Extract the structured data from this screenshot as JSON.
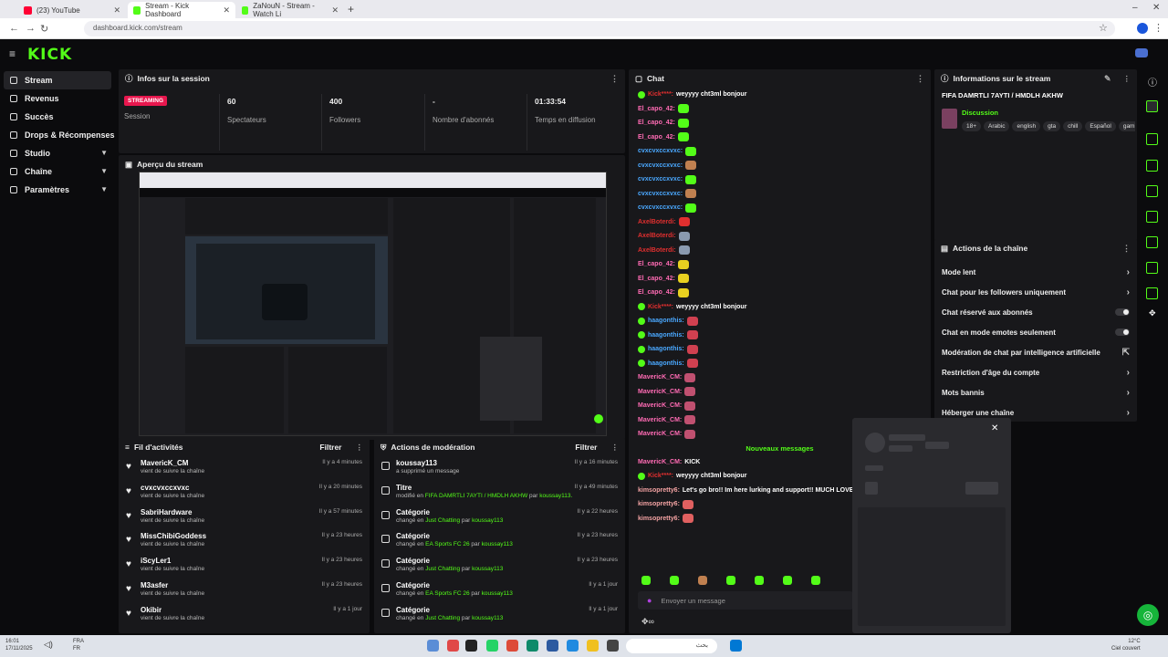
{
  "browser": {
    "tabs": [
      {
        "title": "(23) YouTube",
        "fav": "#ff0033"
      },
      {
        "title": "Stream - Kick Dashboard",
        "fav": "#53fc18"
      },
      {
        "title": "ZaNouN - Stream - Watch Li",
        "fav": "#53fc18"
      }
    ],
    "url": "dashboard.kick.com/stream"
  },
  "app": {
    "logo": "KICK"
  },
  "sidebar": {
    "items": [
      {
        "label": "Stream",
        "active": true
      },
      {
        "label": "Revenus"
      },
      {
        "label": "Succès"
      },
      {
        "label": "Drops & Récompenses"
      },
      {
        "label": "Studio",
        "expand": true
      },
      {
        "label": "Chaîne",
        "expand": true
      },
      {
        "label": "Paramètres",
        "expand": true
      }
    ]
  },
  "session": {
    "title": "Infos sur la session",
    "badge": "STREAMING",
    "badge_label": "Session",
    "stats": [
      {
        "value": "60",
        "label": "Spectateurs"
      },
      {
        "value": "400",
        "label": "Followers"
      },
      {
        "value": "-",
        "label": "Nombre d'abonnés"
      },
      {
        "value": "01:33:54",
        "label": "Temps en diffusion"
      }
    ]
  },
  "preview": {
    "title": "Aperçu du stream"
  },
  "activity": {
    "title": "Fil d'activités",
    "filter": "Filtrer",
    "items": [
      {
        "name": "MavericK_CM",
        "sub": "vient de suivre la chaîne",
        "time": "Il y a 4 minutes"
      },
      {
        "name": "cvxcvxccxvxc",
        "sub": "vient de suivre la chaîne",
        "time": "Il y a 20 minutes"
      },
      {
        "name": "SabriHardware",
        "sub": "vient de suivre la chaîne",
        "time": "Il y a 57 minutes"
      },
      {
        "name": "MissChibiGoddess",
        "sub": "vient de suivre la chaîne",
        "time": "Il y a 23 heures"
      },
      {
        "name": "iScyLer1",
        "sub": "vient de suivre la chaîne",
        "time": "Il y a 23 heures"
      },
      {
        "name": "M3asfer",
        "sub": "vient de suivre la chaîne",
        "time": "Il y a 23 heures"
      },
      {
        "name": "Okibir",
        "sub": "vient de suivre la chaîne",
        "time": "Il y a 1 jour"
      }
    ]
  },
  "moderation": {
    "title": "Actions de modération",
    "filter": "Filtrer",
    "items": [
      {
        "name": "koussay113",
        "pre": "a supprimé un message",
        "hl": "",
        "mid": "",
        "user": "",
        "time": "Il y a 16 minutes"
      },
      {
        "name": "Titre",
        "pre": "modifié en ",
        "hl": "FIFA DAMRTLI 7AYTI / HMDLH AKHW",
        "mid": " par ",
        "user": "koussay113.",
        "time": "Il y a 49 minutes"
      },
      {
        "name": "Catégorie",
        "pre": "changé en ",
        "hl": "Just Chatting",
        "mid": " par ",
        "user": "koussay113",
        "time": "Il y a 22 heures"
      },
      {
        "name": "Catégorie",
        "pre": "changé en ",
        "hl": "EA Sports FC 26",
        "mid": " par ",
        "user": "koussay113",
        "time": "Il y a 23 heures"
      },
      {
        "name": "Catégorie",
        "pre": "changé en ",
        "hl": "Just Chatting",
        "mid": " par ",
        "user": "koussay113",
        "time": "Il y a 23 heures"
      },
      {
        "name": "Catégorie",
        "pre": "changé en ",
        "hl": "EA Sports FC 26",
        "mid": " par ",
        "user": "koussay113",
        "time": "Il y a 1 jour"
      },
      {
        "name": "Catégorie",
        "pre": "changé en ",
        "hl": "Just Chatting",
        "mid": " par ",
        "user": "koussay113",
        "time": "Il y a 1 jour"
      }
    ]
  },
  "chat": {
    "title": "Chat",
    "messages": [
      {
        "user": "Kick****:",
        "color": "rd",
        "badge": true,
        "text": "weyyyy cht3ml bonjour",
        "emote": ""
      },
      {
        "user": "El_capo_42:",
        "color": "pk",
        "badge": false,
        "text": "",
        "emote": "#53fc18"
      },
      {
        "user": "El_capo_42:",
        "color": "pk",
        "badge": false,
        "text": "",
        "emote": "#53fc18"
      },
      {
        "user": "El_capo_42:",
        "color": "pk",
        "badge": false,
        "text": "",
        "emote": "#53fc18"
      },
      {
        "user": "cvxcvxccxvxc:",
        "color": "bl",
        "badge": false,
        "text": "",
        "emote": "#53fc18"
      },
      {
        "user": "cvxcvxccxvxc:",
        "color": "bl",
        "badge": false,
        "text": "",
        "emote": "#c08050"
      },
      {
        "user": "cvxcvxccxvxc:",
        "color": "bl",
        "badge": false,
        "text": "",
        "emote": "#53fc18"
      },
      {
        "user": "cvxcvxccxvxc:",
        "color": "bl",
        "badge": false,
        "text": "",
        "emote": "#c08050"
      },
      {
        "user": "cvxcvxccxvxc:",
        "color": "bl",
        "badge": false,
        "text": "",
        "emote": "#53fc18"
      },
      {
        "user": "AxelBoterdi:",
        "color": "rd",
        "badge": false,
        "text": "",
        "emote": "#e02f2f"
      },
      {
        "user": "AxelBoterdi:",
        "color": "rd",
        "badge": false,
        "text": "",
        "emote": "#8a9ab0"
      },
      {
        "user": "AxelBoterdi:",
        "color": "rd",
        "badge": false,
        "text": "",
        "emote": "#8a9ab0"
      },
      {
        "user": "El_capo_42:",
        "color": "pk",
        "badge": false,
        "text": "",
        "emote": "#e8d020"
      },
      {
        "user": "El_capo_42:",
        "color": "pk",
        "badge": false,
        "text": "",
        "emote": "#e8d020"
      },
      {
        "user": "El_capo_42:",
        "color": "pk",
        "badge": false,
        "text": "",
        "emote": "#e8d020"
      },
      {
        "user": "Kick****:",
        "color": "rd",
        "badge": true,
        "text": "weyyyy cht3ml bonjour",
        "emote": ""
      },
      {
        "user": "haagonthis:",
        "color": "bl",
        "badge": true,
        "text": "",
        "emote": "#d04050"
      },
      {
        "user": "haagonthis:",
        "color": "bl",
        "badge": true,
        "text": "",
        "emote": "#d04050"
      },
      {
        "user": "haagonthis:",
        "color": "bl",
        "badge": true,
        "text": "",
        "emote": "#d04050"
      },
      {
        "user": "haagonthis:",
        "color": "bl",
        "badge": true,
        "text": "",
        "emote": "#d04050"
      },
      {
        "user": "MavericK_CM:",
        "color": "pk",
        "badge": false,
        "text": "",
        "emote": "#c05070"
      },
      {
        "user": "MavericK_CM:",
        "color": "pk",
        "badge": false,
        "text": "",
        "emote": "#c05070"
      },
      {
        "user": "MavericK_CM:",
        "color": "pk",
        "badge": false,
        "text": "",
        "emote": "#c05070"
      },
      {
        "user": "MavericK_CM:",
        "color": "pk",
        "badge": false,
        "text": "",
        "emote": "#c05070"
      },
      {
        "user": "MavericK_CM:",
        "color": "pk",
        "badge": false,
        "text": "",
        "emote": "#c05070"
      }
    ],
    "new_label": "Nouveaux messages",
    "new_messages": [
      {
        "user": "MavericK_CM:",
        "color": "pk",
        "badge": false,
        "text": "KICK",
        "emote": ""
      },
      {
        "user": "Kick****:",
        "color": "rd",
        "badge": true,
        "text": "weyyyy cht3ml bonjour",
        "emote": ""
      },
      {
        "user": "kimsopretty6:",
        "color": "bg",
        "badge": false,
        "text": "Let's go bro!! Im here lurking and support!! MUCH LOVE!!",
        "emote": "#e06060"
      },
      {
        "user": "kimsopretty6:",
        "color": "bg",
        "badge": false,
        "text": "",
        "emote": "#e06060"
      },
      {
        "user": "kimsopretty6:",
        "color": "bg",
        "badge": false,
        "text": "",
        "emote": "#e06060"
      }
    ],
    "input_placeholder": "Envoyer un message"
  },
  "stream_info": {
    "title": "Informations sur le stream",
    "stream_title": "FIFA DAMRTLI 7AYTI / HMDLH AKHW",
    "category": "Discussion",
    "tags": [
      "18+",
      "Arabic",
      "english",
      "gta",
      "chill",
      "Español",
      "gami"
    ]
  },
  "channel_actions": {
    "title": "Actions de la chaîne",
    "items": [
      {
        "label": "Mode lent",
        "ctl": "chevron"
      },
      {
        "label": "Chat pour les followers uniquement",
        "ctl": "chevron"
      },
      {
        "label": "Chat réservé aux abonnés",
        "ctl": "toggle"
      },
      {
        "label": "Chat en mode emotes seulement",
        "ctl": "toggle"
      },
      {
        "label": "Modération de chat par intelligence artificielle",
        "ctl": "external"
      },
      {
        "label": "Restriction d'âge du compte",
        "ctl": "chevron"
      },
      {
        "label": "Mots bannis",
        "ctl": "chevron"
      },
      {
        "label": "Héberger une chaîne",
        "ctl": "chevron"
      }
    ]
  },
  "taskbar": {
    "clock": "16:01",
    "date": "17/11/2025",
    "lang": "FRA",
    "lang2": "FR",
    "weather_temp": "12°C",
    "weather_label": "Ciel couvert",
    "search_text": "بحث"
  }
}
